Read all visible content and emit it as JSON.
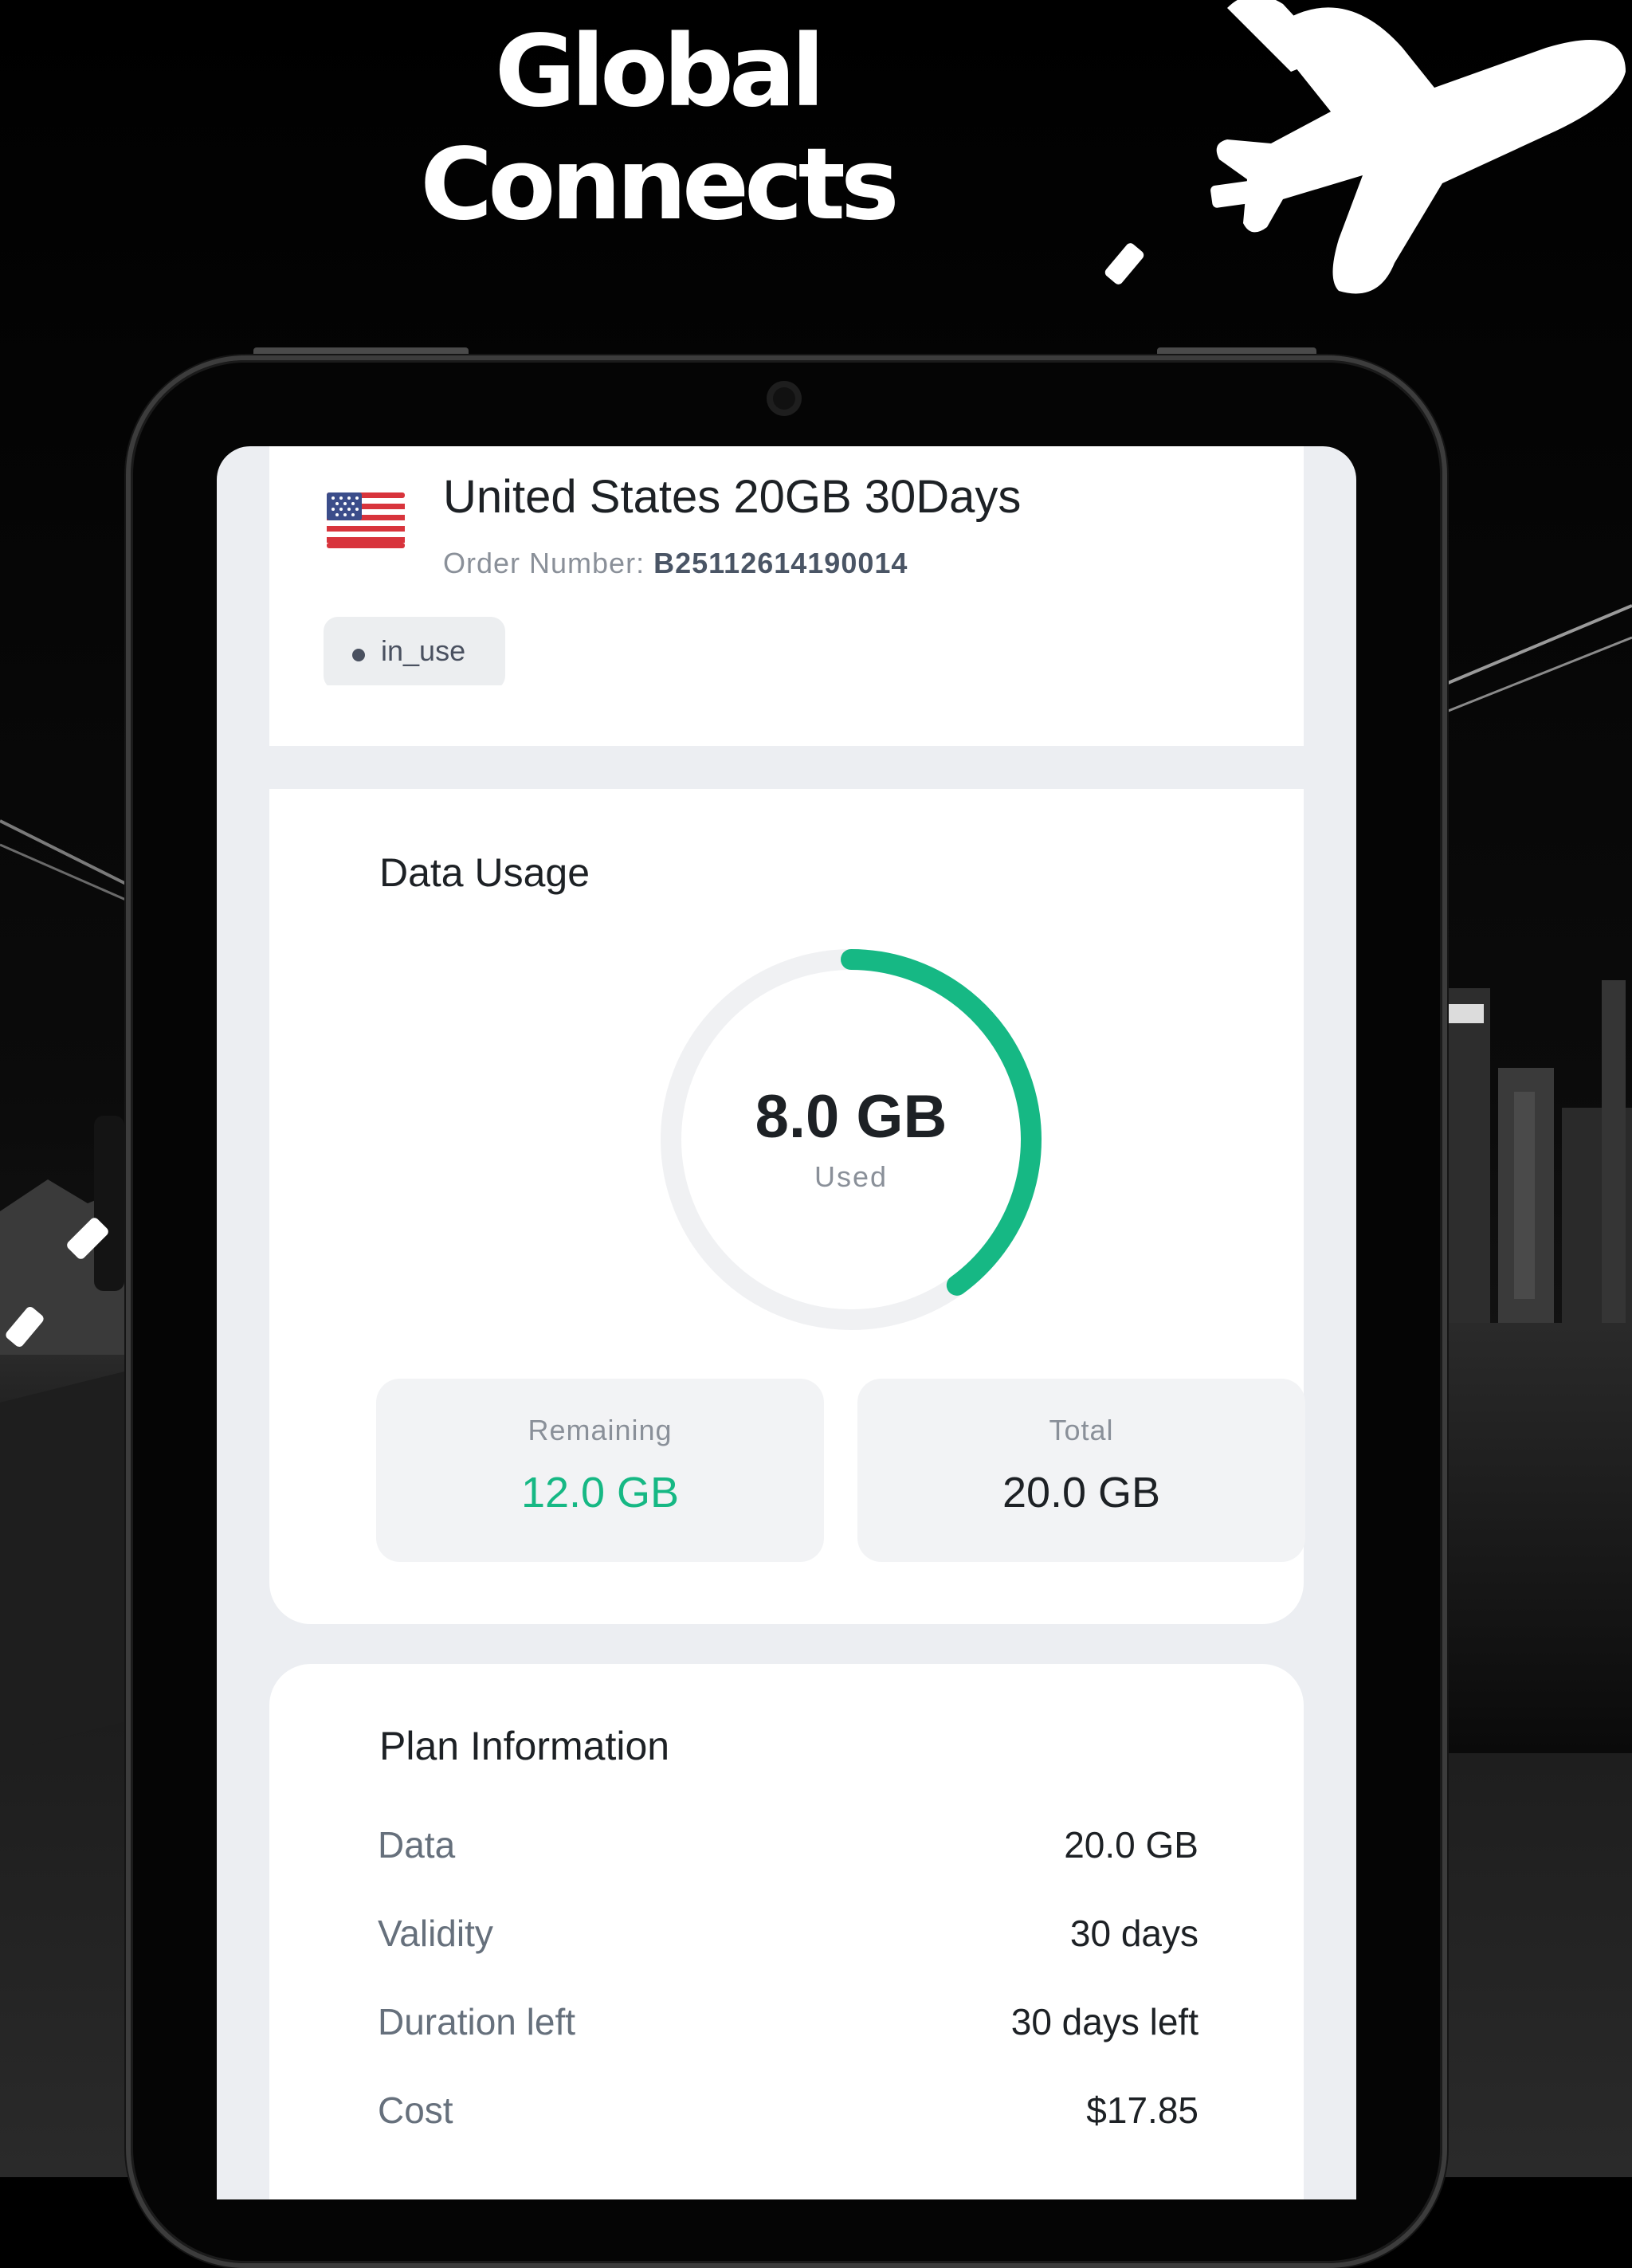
{
  "promo": {
    "headline_line1": "Global",
    "headline_line2": "Connects"
  },
  "icons": {
    "plane": "airplane-icon",
    "flag": "us-flag-icon",
    "status_dot": "dot-icon"
  },
  "colors": {
    "accent_green": "#16b884",
    "ring_track": "#f0f1f3",
    "card_background": "#ffffff",
    "screen_background": "#eceef2"
  },
  "plan_header": {
    "title": "United States 20GB 30Days",
    "order_label": "Order Number:",
    "order_number": "B25112614190014",
    "status": "in_use"
  },
  "data_usage": {
    "heading": "Data Usage",
    "used_value": "8.0 GB",
    "used_label": "Used",
    "used_fraction": 0.4,
    "remaining_label": "Remaining",
    "remaining_value": "12.0 GB",
    "total_label": "Total",
    "total_value": "20.0 GB"
  },
  "plan_info": {
    "heading": "Plan Information",
    "rows": [
      {
        "label": "Data",
        "value": "20.0 GB"
      },
      {
        "label": "Validity",
        "value": "30 days"
      },
      {
        "label": "Duration left",
        "value": "30 days left"
      },
      {
        "label": "Cost",
        "value": "$17.85"
      }
    ]
  }
}
